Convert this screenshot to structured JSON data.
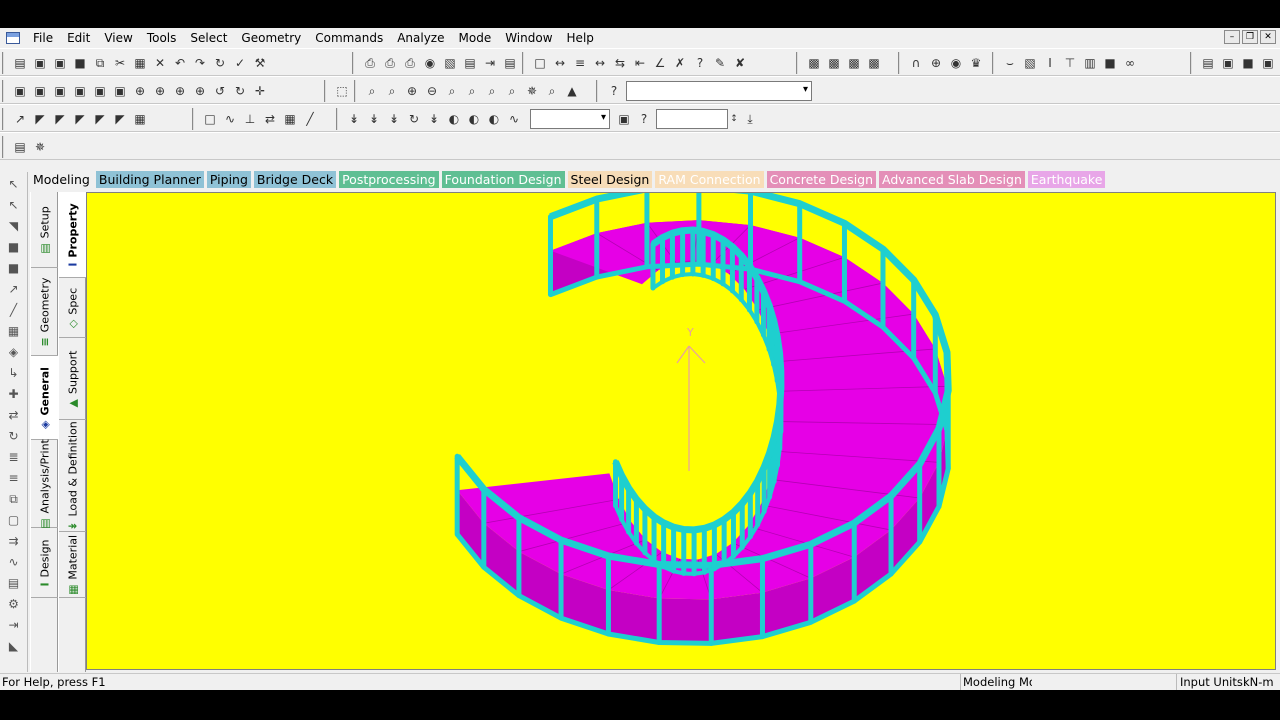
{
  "menu": [
    "File",
    "Edit",
    "View",
    "Tools",
    "Select",
    "Geometry",
    "Commands",
    "Analyze",
    "Mode",
    "Window",
    "Help"
  ],
  "window_controls": {
    "minimize": "–",
    "restore": "❐",
    "close": "✕"
  },
  "toolbar": {
    "row1": [
      {
        "icon": "new-file-icon",
        "glyph": "▤"
      },
      {
        "icon": "open-folder-icon",
        "glyph": "▣"
      },
      {
        "icon": "open-icon",
        "glyph": "▣"
      },
      {
        "icon": "save-icon",
        "glyph": "■"
      },
      {
        "icon": "copy-icon",
        "glyph": "⧉"
      },
      {
        "icon": "cut-icon",
        "glyph": "✂"
      },
      {
        "icon": "paste-icon",
        "glyph": "▦"
      },
      {
        "icon": "delete-icon",
        "glyph": "✕"
      },
      {
        "icon": "undo-icon",
        "glyph": "↶"
      },
      {
        "icon": "redo-icon",
        "glyph": "↷"
      },
      {
        "icon": "refresh-icon",
        "glyph": "↻"
      },
      {
        "icon": "check-icon",
        "glyph": "✓"
      },
      {
        "icon": "build-icon",
        "glyph": "⚒"
      }
    ],
    "row1_group2": [
      {
        "icon": "print-icon",
        "glyph": "⎙"
      },
      {
        "icon": "print-preview-icon",
        "glyph": "⎙"
      },
      {
        "icon": "print-setup-icon",
        "glyph": "⎙"
      },
      {
        "icon": "camera-icon",
        "glyph": "◉"
      },
      {
        "icon": "picture-icon",
        "glyph": "▧"
      },
      {
        "icon": "report-icon",
        "glyph": "▤"
      },
      {
        "icon": "export-icon",
        "glyph": "⇥"
      },
      {
        "icon": "report-setup-icon",
        "glyph": "▤"
      }
    ],
    "row1_group3": [
      {
        "icon": "page-icon",
        "glyph": "□"
      },
      {
        "icon": "dimension-icon",
        "glyph": "↔"
      },
      {
        "icon": "label-icon",
        "glyph": "≡"
      },
      {
        "icon": "measure-icon",
        "glyph": "↔"
      },
      {
        "icon": "node-distance-icon",
        "glyph": "⇆"
      },
      {
        "icon": "beam-measure-icon",
        "glyph": "⇤"
      },
      {
        "icon": "angle-icon",
        "glyph": "∠"
      },
      {
        "icon": "clear-icon",
        "glyph": "✗"
      },
      {
        "icon": "help-query-icon",
        "glyph": "?"
      },
      {
        "icon": "pen-icon",
        "glyph": "✎"
      },
      {
        "icon": "eraser-icon",
        "glyph": "✘"
      }
    ],
    "row1_group4": [
      {
        "icon": "render-icon",
        "glyph": "▩"
      },
      {
        "icon": "render-wire-icon",
        "glyph": "▩"
      },
      {
        "icon": "render-color-icon",
        "glyph": "▩"
      },
      {
        "icon": "render-shade-icon",
        "glyph": "▩"
      }
    ],
    "row1_group5": [
      {
        "icon": "arch-icon",
        "glyph": "∩"
      },
      {
        "icon": "frame-icon",
        "glyph": "⊕"
      },
      {
        "icon": "eye-icon",
        "glyph": "◉"
      },
      {
        "icon": "crown-icon",
        "glyph": "♛"
      }
    ],
    "row1_group6": [
      {
        "icon": "slab-icon",
        "glyph": "⌣"
      },
      {
        "icon": "member-icon",
        "glyph": "▧"
      },
      {
        "icon": "i-beam-icon",
        "glyph": "I"
      },
      {
        "icon": "t-beam-icon",
        "glyph": "⊤"
      },
      {
        "icon": "sheet-icon",
        "glyph": "▥"
      },
      {
        "icon": "plate-icon",
        "glyph": "■"
      },
      {
        "icon": "link-icon",
        "glyph": "∞"
      }
    ],
    "row1_group7": [
      {
        "icon": "window-icon",
        "glyph": "▤"
      },
      {
        "icon": "folder-icon",
        "glyph": "▣"
      },
      {
        "icon": "save-all-icon",
        "glyph": "■"
      },
      {
        "icon": "settings-icon",
        "glyph": "▣"
      }
    ],
    "row2": [
      {
        "icon": "view-iso-icon",
        "glyph": "▣"
      },
      {
        "icon": "view-front-icon",
        "glyph": "▣"
      },
      {
        "icon": "view-back-icon",
        "glyph": "▣"
      },
      {
        "icon": "view-left-icon",
        "glyph": "▣"
      },
      {
        "icon": "view-right-icon",
        "glyph": "▣"
      },
      {
        "icon": "view-top-icon",
        "glyph": "▣"
      },
      {
        "icon": "rotate-up-icon",
        "glyph": "⊕"
      },
      {
        "icon": "rotate-down-icon",
        "glyph": "⊕"
      },
      {
        "icon": "rotate-left-icon",
        "glyph": "⊕"
      },
      {
        "icon": "rotate-right-icon",
        "glyph": "⊕"
      },
      {
        "icon": "spin-left-icon",
        "glyph": "↺"
      },
      {
        "icon": "spin-right-icon",
        "glyph": "↻"
      },
      {
        "icon": "pan-icon",
        "glyph": "✛"
      }
    ],
    "row2_group2": [
      {
        "icon": "select-window-icon",
        "glyph": "⬚"
      }
    ],
    "row2_group3": [
      {
        "icon": "zoom-icon",
        "glyph": "⌕"
      },
      {
        "icon": "zoom-window-icon",
        "glyph": "⌕"
      },
      {
        "icon": "zoom-in-icon",
        "glyph": "⊕"
      },
      {
        "icon": "zoom-out-icon",
        "glyph": "⊖"
      },
      {
        "icon": "zoom-prev-icon",
        "glyph": "⌕"
      },
      {
        "icon": "zoom-dynamic-icon",
        "glyph": "⌕"
      },
      {
        "icon": "zoom-all-icon",
        "glyph": "⌕"
      },
      {
        "icon": "zoom-extents-icon",
        "glyph": "⌕"
      },
      {
        "icon": "pan-view-icon",
        "glyph": "✵"
      },
      {
        "icon": "magnifier-icon",
        "glyph": "⌕"
      },
      {
        "icon": "display-icon",
        "glyph": "▲"
      }
    ],
    "row2_group4": [
      {
        "icon": "help-icon",
        "glyph": "?"
      }
    ],
    "row3": [
      {
        "icon": "structure-icon",
        "glyph": "↗"
      },
      {
        "icon": "beam-cursor-icon",
        "glyph": "◤"
      },
      {
        "icon": "plate-cursor-icon",
        "glyph": "◤"
      },
      {
        "icon": "solid-cursor-icon",
        "glyph": "◤"
      },
      {
        "icon": "surface-cursor-icon",
        "glyph": "◤"
      },
      {
        "icon": "geometry-cursor-icon",
        "glyph": "◤"
      },
      {
        "icon": "grid-icon",
        "glyph": "▦"
      }
    ],
    "row3_group2": [
      {
        "icon": "node-icon",
        "glyph": "□"
      },
      {
        "icon": "curve-icon",
        "glyph": "∿"
      },
      {
        "icon": "pins-icon",
        "glyph": "⊥"
      },
      {
        "icon": "flip-icon",
        "glyph": "⇄"
      },
      {
        "icon": "table-icon",
        "glyph": "▦"
      },
      {
        "icon": "line-icon",
        "glyph": "╱"
      }
    ],
    "row3_group3": [
      {
        "icon": "load-icon",
        "glyph": "↡"
      },
      {
        "icon": "load-node-icon",
        "glyph": "↡"
      },
      {
        "icon": "load-member-icon",
        "glyph": "↡"
      },
      {
        "icon": "load-rotate-icon",
        "glyph": "↻"
      },
      {
        "icon": "load-area-icon",
        "glyph": "↡"
      },
      {
        "icon": "load-bubble-icon",
        "glyph": "◐"
      },
      {
        "icon": "load-plate-icon",
        "glyph": "◐"
      },
      {
        "icon": "load-solid-icon",
        "glyph": "◐"
      },
      {
        "icon": "load-case-icon",
        "glyph": "∿"
      }
    ],
    "row3_group4": [
      {
        "icon": "monitor-icon",
        "glyph": "▣"
      },
      {
        "icon": "query-icon",
        "glyph": "?"
      }
    ],
    "row4": [
      {
        "icon": "structure-wizard-icon",
        "glyph": "▤"
      },
      {
        "icon": "transform-icon",
        "glyph": "✵"
      }
    ]
  },
  "page_tabs": [
    {
      "label": "Modeling",
      "color": "#f0f0f0",
      "text": "#000000"
    },
    {
      "label": "Building Planner",
      "color": "#8fc2d6",
      "text": "#000000"
    },
    {
      "label": "Piping",
      "color": "#8fc2d6",
      "text": "#000000"
    },
    {
      "label": "Bridge Deck",
      "color": "#8fc2d6",
      "text": "#000000"
    },
    {
      "label": "Postprocessing",
      "color": "#5fbf93",
      "text": "#ffffff"
    },
    {
      "label": "Foundation Design",
      "color": "#5fbf93",
      "text": "#ffffff"
    },
    {
      "label": "Steel Design",
      "color": "#f6dcb8",
      "text": "#000000"
    },
    {
      "label": "RAM Connection",
      "color": "#f8ddb8",
      "text": "#ffffff"
    },
    {
      "label": "Concrete Design",
      "color": "#e48fb8",
      "text": "#ffffff"
    },
    {
      "label": "Advanced Slab Design",
      "color": "#e48fb8",
      "text": "#ffffff"
    },
    {
      "label": "Earthquake",
      "color": "#e8a6e8",
      "text": "#ffffff"
    }
  ],
  "left_strip_icons": [
    {
      "icon": "cursor-icon",
      "glyph": "↖"
    },
    {
      "icon": "cursor-node-icon",
      "glyph": "↖"
    },
    {
      "icon": "cursor-beam-icon",
      "glyph": "◥"
    },
    {
      "icon": "cursor-plate-icon",
      "glyph": "■"
    },
    {
      "icon": "cursor-solid-icon",
      "glyph": "■"
    },
    {
      "icon": "cursor-surface-icon",
      "glyph": "↗"
    },
    {
      "icon": "cursor-geometry-icon",
      "glyph": "╱"
    },
    {
      "icon": "cursor-parallel-icon",
      "glyph": "▦"
    },
    {
      "icon": "cursor-load-icon",
      "glyph": "◈"
    },
    {
      "icon": "cursor-label-icon",
      "glyph": "↳"
    },
    {
      "icon": "cursor-support-icon",
      "glyph": "✚"
    },
    {
      "icon": "cursor-move-icon",
      "glyph": "⇄"
    },
    {
      "icon": "cursor-rotate-icon",
      "glyph": "↻"
    },
    {
      "icon": "cursor-stairs-icon",
      "glyph": "≣"
    },
    {
      "icon": "cursor-list-icon",
      "glyph": "≡"
    },
    {
      "icon": "cursor-copy-icon",
      "glyph": "⧉"
    },
    {
      "icon": "cursor-window-icon",
      "glyph": "▢"
    },
    {
      "icon": "cursor-arrows-icon",
      "glyph": "⇉"
    },
    {
      "icon": "cursor-spring-icon",
      "glyph": "∿"
    },
    {
      "icon": "cursor-mesh-icon",
      "glyph": "▤"
    },
    {
      "icon": "cursor-wizard-icon",
      "glyph": "⚙"
    },
    {
      "icon": "cursor-flip-icon",
      "glyph": "⇥"
    },
    {
      "icon": "cursor-end-icon",
      "glyph": "◣"
    }
  ],
  "outer_vertical_tabs": [
    {
      "label": "Setup",
      "glyph": "▤"
    },
    {
      "label": "Geometry",
      "glyph": "≡"
    },
    {
      "label": "General",
      "glyph": "◈"
    },
    {
      "label": "Analysis/Print",
      "glyph": "▤"
    },
    {
      "label": "Design",
      "glyph": "I"
    }
  ],
  "inner_vertical_tabs": [
    {
      "label": "Property",
      "glyph": "I"
    },
    {
      "label": "Spec",
      "glyph": "◇"
    },
    {
      "label": "Support",
      "glyph": "▲"
    },
    {
      "label": "Load & Definition",
      "glyph": "↡"
    },
    {
      "label": "Material",
      "glyph": "▦"
    }
  ],
  "viewport": {
    "background": "#ffff00",
    "deck_color": "#e600e6",
    "deck_dark": "#c400c4",
    "rail_color": "#1ecfcf",
    "axis_color": "#e8a0a0",
    "axis_label": "Y"
  },
  "status": {
    "help": "For Help, press F1",
    "mode": "Modeling Mo",
    "units_label": "Input Units:",
    "units_value": "kN-m"
  }
}
